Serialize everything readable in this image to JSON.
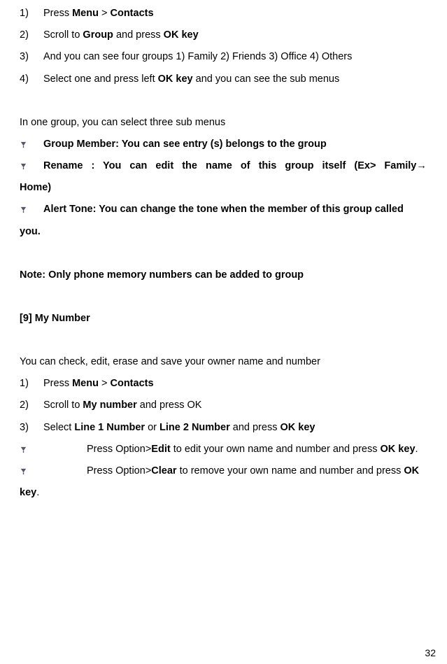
{
  "s1": {
    "n1": "1)",
    "t1a": "Press ",
    "t1b": "Menu",
    "t1c": " > ",
    "t1d": "Contacts",
    "n2": "2)",
    "t2a": "Scroll to ",
    "t2b": "Group",
    "t2c": " and press ",
    "t2d": "OK key",
    "n3": "3)",
    "t3": "And you can see four groups 1) Family 2) Friends 3) Office 4) Others",
    "n4": "4)",
    "t4a": "Select one and press left ",
    "t4b": "OK key",
    "t4c": " and you can see the sub menus"
  },
  "intro": "In one group, you can select three sub menus",
  "b1": "Group Member: You can see entry (s) belongs to the group",
  "b2a": "Rename : You can edit the name of this group itself (Ex> Family→",
  "b2b": "Home)",
  "b3a": "Alert Tone: You can change the tone when the member of this group called",
  "b3b": "you.",
  "note": "Note: Only phone memory numbers can be added to group",
  "heading": "[9]    My Number",
  "desc": "You can check, edit, erase and save your owner name and number",
  "s2": {
    "n1": "1)",
    "t1a": "Press ",
    "t1b": "Menu",
    "t1c": " > ",
    "t1d": "Contacts",
    "n2": "2)",
    "t2a": "Scroll to ",
    "t2b": "My number",
    "t2c": " and press OK",
    "n3": "3)",
    "t3a": "Select ",
    "t3b": "Line 1 Number",
    "t3c": " or ",
    "t3d": "Line 2 Number",
    "t3e": " and press ",
    "t3f": "OK key"
  },
  "b4a": "Press Option>",
  "b4b": "Edit",
  "b4c": " to edit your own name and number and press ",
  "b4d": "OK key",
  "b4e": ".",
  "b5a": "Press Option>",
  "b5b": "Clear",
  "b5c": " to remove your own name and number and press ",
  "b5d": "OK",
  "b5e": "key",
  "b5f": ".",
  "page_num": "32"
}
